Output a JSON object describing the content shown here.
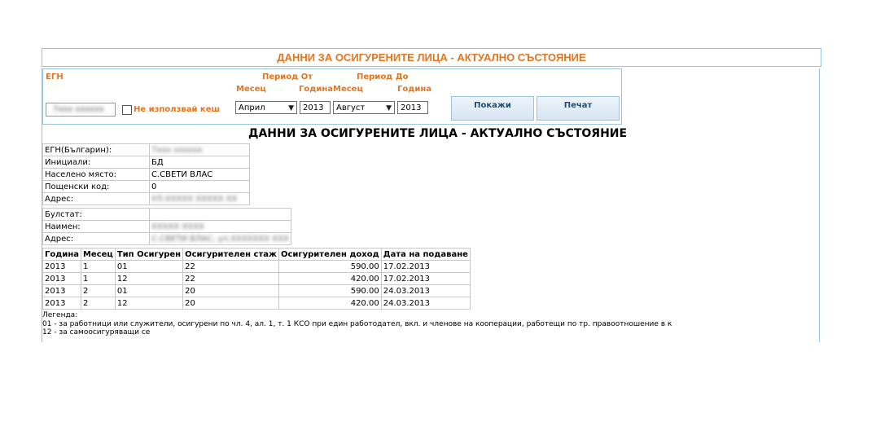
{
  "header": {
    "title": "ДАННИ ЗА ОСИГУРЕНИТЕ ЛИЦА - АКТУАЛНО СЪСТОЯНИЕ"
  },
  "filters": {
    "egn_label": "ЕГН",
    "egn_value": "7xxx xxxxxx",
    "no_cache_label": "Не използвай кеш",
    "period_from_label": "Период От",
    "period_to_label": "Период До",
    "month_label_from": "Месец",
    "year_label_from": "Година",
    "month_label_to": "Месец",
    "year_label_to": "Година",
    "from_month": "Април",
    "from_year": "2013",
    "to_month": "Август",
    "to_year": "2013",
    "show_button": "Покажи",
    "print_button": "Печат"
  },
  "report": {
    "title": "ДАННИ ЗА ОСИГУРЕНИТЕ ЛИЦА - АКТУАЛНО СЪСТОЯНИЕ",
    "person": {
      "egn_label": "ЕГН(Българин):",
      "egn_value": "7xxx xxxxxx",
      "initials_label": "Инициали:",
      "initials_value": "БД",
      "place_label": "Населено място:",
      "place_value": "С.СВЕТИ ВЛАС",
      "postcode_label": "Пощенски код:",
      "postcode_value": "0",
      "address_label": "Адрес:",
      "address_value": "УЛ.ХХХХХ ХХХХХ ХХ"
    },
    "employer": {
      "bulstat_label": "Булстат:",
      "bulstat_value": "",
      "name_label": "Наимен:",
      "name_value": "ХХХХХ ХХХХ",
      "address_label": "Адрес:",
      "address_value": "С.СВЕТИ ВЛАС, ул.ХХХХХХХ ХХХ"
    },
    "table": {
      "columns": [
        "Година",
        "Месец",
        "Тип Осигурен",
        "Осигурителен стаж",
        "Осигурителен доход",
        "Дата на подаване"
      ],
      "rows": [
        [
          "2013",
          "1",
          "01",
          "22",
          "590.00",
          "17.02.2013"
        ],
        [
          "2013",
          "1",
          "12",
          "22",
          "420.00",
          "17.02.2013"
        ],
        [
          "2013",
          "2",
          "01",
          "20",
          "590.00",
          "24.03.2013"
        ],
        [
          "2013",
          "2",
          "12",
          "20",
          "420.00",
          "24.03.2013"
        ]
      ]
    },
    "legend": {
      "title": "Легенда:",
      "line1": "01 - за работници или служители, осигурени по чл. 4, ал. 1, т. 1 КСО при един работодател, вкл. и членове на кооперации, работещи по тр. правоотношение в к",
      "line2": "12 - за самоосигуряващи се"
    }
  }
}
